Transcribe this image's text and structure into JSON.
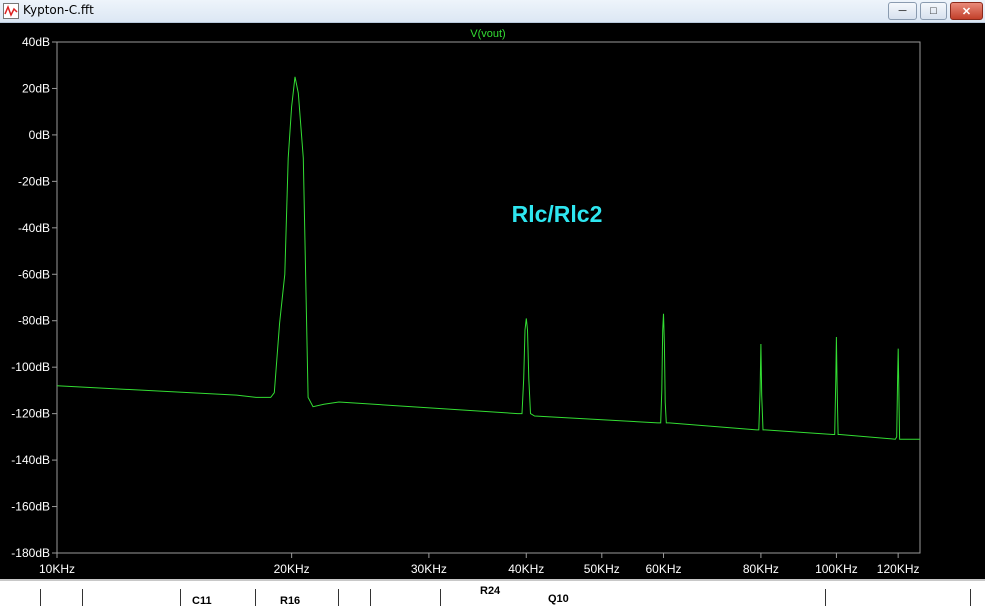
{
  "window": {
    "title": "Kypton-C.fft",
    "minimize_icon": "minimize-icon",
    "maximize_icon": "maximize-icon",
    "close_icon": "close-icon"
  },
  "colors": {
    "background": "#000000",
    "axis": "#9a9a9a",
    "trace": "#33dd33",
    "trace_label": "#33dd33",
    "annotation": "#2ee6f0",
    "tick_text": "#ffffff"
  },
  "chart_data": {
    "type": "line",
    "title": "V(vout)",
    "annotation": "Rlc/Rlc2",
    "x_scale": "log",
    "xlim": [
      10000,
      128000
    ],
    "ylim": [
      -180,
      40
    ],
    "y_ticks": [
      40,
      20,
      0,
      -20,
      -40,
      -60,
      -80,
      -100,
      -120,
      -140,
      -160,
      -180
    ],
    "y_tick_labels": [
      "40dB",
      "20dB",
      "0dB",
      "-20dB",
      "-40dB",
      "-60dB",
      "-80dB",
      "-100dB",
      "-120dB",
      "-140dB",
      "-160dB",
      "-180dB"
    ],
    "x_ticks": [
      10000,
      20000,
      30000,
      40000,
      50000,
      60000,
      80000,
      100000,
      120000
    ],
    "x_tick_labels": [
      "10KHz",
      "20KHz",
      "30KHz",
      "40KHz",
      "50KHz",
      "60KHz",
      "80KHz",
      "100KHz",
      "120KHz"
    ],
    "grid": false,
    "series": [
      {
        "name": "V(vout)",
        "x": [
          10000,
          17000,
          18000,
          18800,
          19000,
          19300,
          19600,
          19800,
          20000,
          20200,
          20400,
          20700,
          21000,
          21300,
          22000,
          23000,
          39000,
          39500,
          39700,
          39850,
          40000,
          40150,
          40300,
          40500,
          41000,
          59000,
          59500,
          59700,
          59850,
          60000,
          60150,
          60300,
          60500,
          61000,
          79000,
          79500,
          79800,
          80000,
          80200,
          80500,
          81000,
          99000,
          99500,
          99800,
          100000,
          100200,
          100500,
          101000,
          119000,
          119500,
          119800,
          120000,
          120200,
          120500,
          121000,
          128000
        ],
        "y": [
          -108,
          -112,
          -113,
          -113,
          -111,
          -81,
          -60,
          -10,
          12,
          25,
          18,
          -10,
          -113,
          -117,
          -116,
          -115,
          -120,
          -120,
          -105,
          -84,
          -79,
          -84,
          -105,
          -120,
          -121,
          -124,
          -124,
          -110,
          -84,
          -77,
          -90,
          -115,
          -124,
          -124,
          -127,
          -127,
          -110,
          -90,
          -112,
          -127,
          -127,
          -129,
          -129,
          -105,
          -87,
          -108,
          -129,
          -129,
          -131,
          -130,
          -105,
          -92,
          -106,
          -131,
          -131,
          -131
        ]
      }
    ]
  },
  "schematic_strip": {
    "labels": [
      "C11",
      "R16",
      "R24",
      "Q10"
    ]
  }
}
